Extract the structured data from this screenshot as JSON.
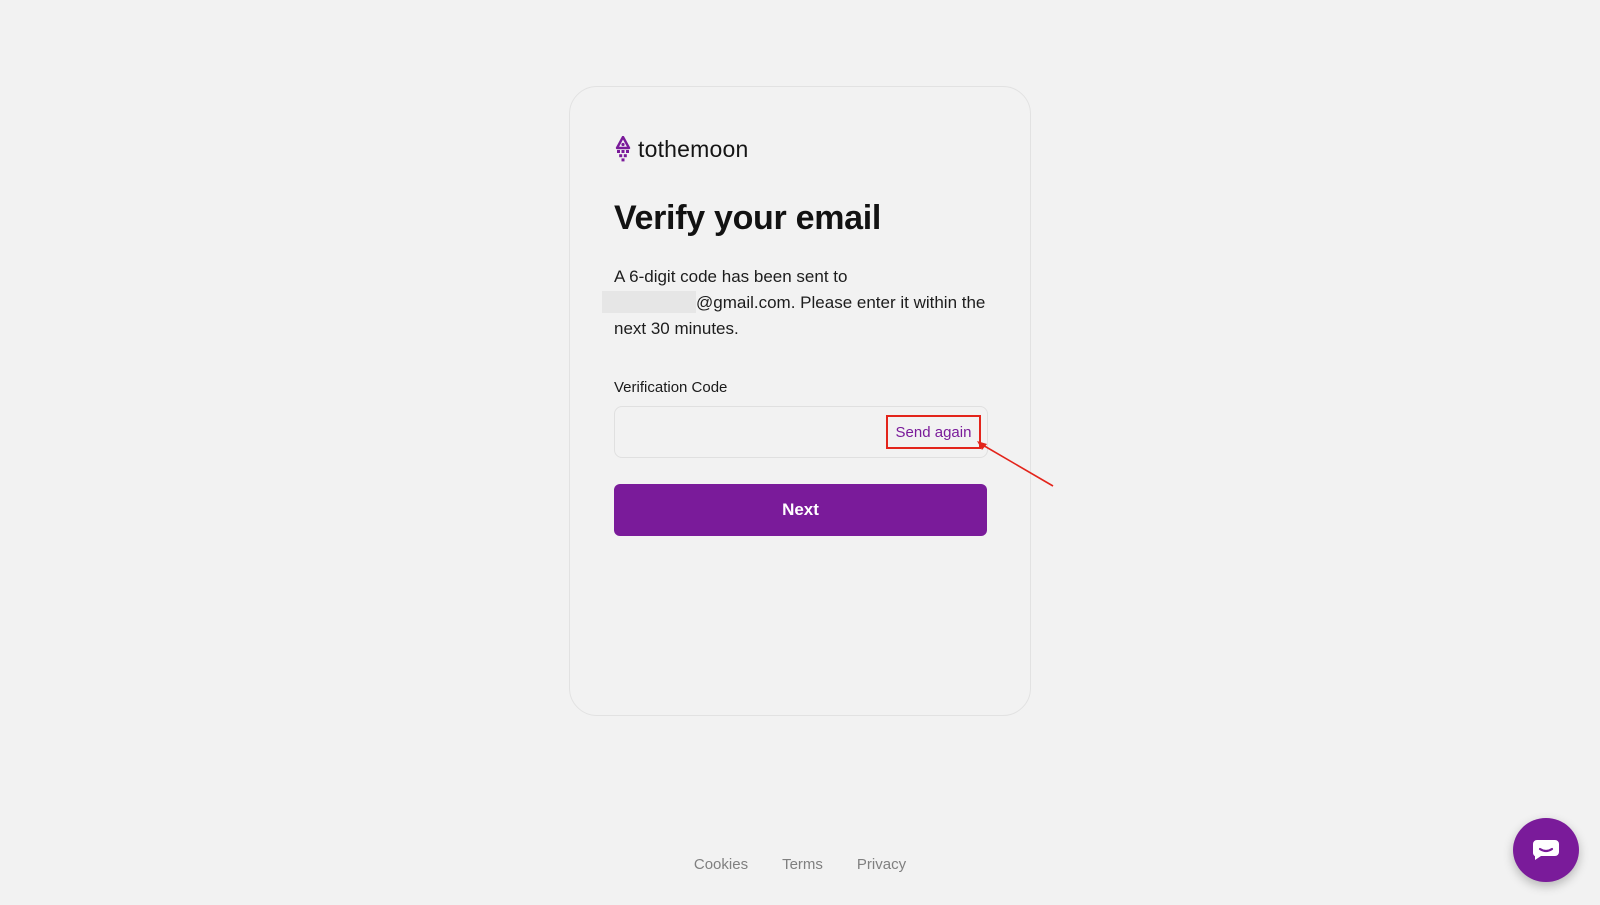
{
  "brand": {
    "name": "tothemoon",
    "icon": "rocket-icon",
    "color": "#7a1b9a"
  },
  "page": {
    "title": "Verify your email",
    "description_line1": "A 6-digit code has been sent to",
    "description_line2": "@gmail.com. Please enter it within the next 30 minutes."
  },
  "form": {
    "code_label": "Verification Code",
    "code_value": "",
    "send_again_label": "Send again",
    "next_label": "Next"
  },
  "footer": {
    "links": [
      "Cookies",
      "Terms",
      "Privacy"
    ]
  },
  "chat": {
    "icon": "chat-icon"
  },
  "colors": {
    "accent": "#7a1b9a",
    "highlight": "#e3241b",
    "background": "#f2f2f2"
  }
}
